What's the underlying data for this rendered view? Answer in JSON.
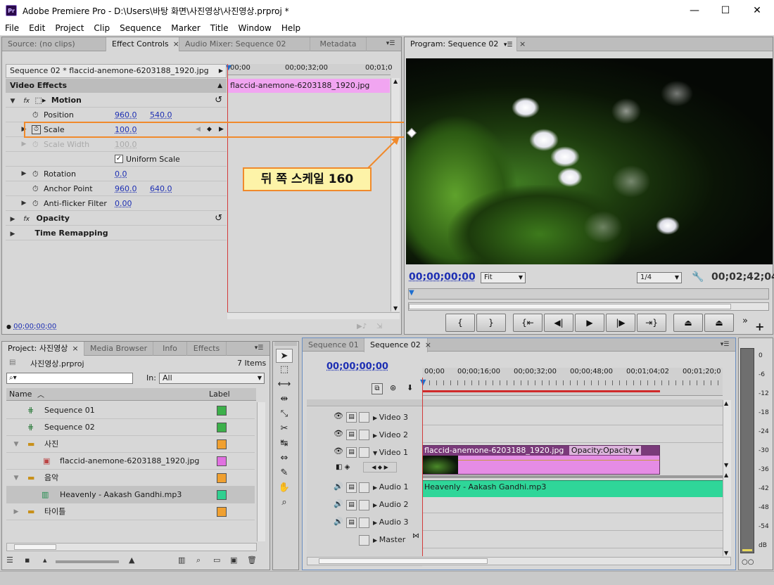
{
  "window": {
    "title": "Adobe Premiere Pro - D:\\Users\\바탕 화면\\사진영상\\사진영상.prproj *",
    "app_icon": "Pr"
  },
  "menu": [
    "File",
    "Edit",
    "Project",
    "Clip",
    "Sequence",
    "Marker",
    "Title",
    "Window",
    "Help"
  ],
  "source_panel": {
    "tabs": [
      "Source: (no clips)",
      "Effect Controls",
      "Audio Mixer: Sequence 02",
      "Metadata"
    ],
    "clip_header": "Sequence 02 * flaccid-anemone-6203188_1920.jpg",
    "ruler": [
      "00;00",
      "00;00;32;00",
      "00;01;0"
    ],
    "clip_bar": "flaccid-anemone-6203188_1920.jpg",
    "video_effects_label": "Video Effects",
    "motion": "Motion",
    "params": {
      "position": {
        "label": "Position",
        "v1": "960.0",
        "v2": "540.0"
      },
      "scale": {
        "label": "Scale",
        "v1": "100.0"
      },
      "scale_width": {
        "label": "Scale Width",
        "v1": "100.0"
      },
      "uniform": "Uniform Scale",
      "rotation": {
        "label": "Rotation",
        "v1": "0.0"
      },
      "anchor": {
        "label": "Anchor Point",
        "v1": "960.0",
        "v2": "640.0"
      },
      "antiflicker": {
        "label": "Anti-flicker Filter",
        "v1": "0.00"
      }
    },
    "opacity": "Opacity",
    "time_remap": "Time Remapping",
    "timecode": "00;00;00;00",
    "callout": "뒤 쪽 스케일 160"
  },
  "program_panel": {
    "tab": "Program: Sequence 02",
    "timecode": "00;00;00;00",
    "fit": "Fit",
    "quality": "1/4",
    "duration": "00;02;42;04"
  },
  "project_panel": {
    "tabs": [
      "Project: 사진영상",
      "Media Browser",
      "Info",
      "Effects"
    ],
    "file": "사진영상.prproj",
    "items_count": "7 Items",
    "in_label": "In:",
    "in_value": "All",
    "col_name": "Name",
    "col_label": "Label",
    "rows": [
      {
        "name": "Sequence 01",
        "color": "#3cb04a",
        "indent": 0
      },
      {
        "name": "Sequence 02",
        "color": "#3cb04a",
        "indent": 0
      },
      {
        "name": "사진",
        "color": "#f0a030",
        "indent": 0
      },
      {
        "name": "flaccid-anemone-6203188_1920.jpg",
        "color": "#e070e0",
        "indent": 1
      },
      {
        "name": "음악",
        "color": "#f0a030",
        "indent": 0
      },
      {
        "name": "Heavenly - Aakash Gandhi.mp3",
        "color": "#30d090",
        "indent": 1
      },
      {
        "name": "타이틀",
        "color": "#f0a030",
        "indent": 0
      }
    ]
  },
  "timeline": {
    "tabs": [
      "Sequence 01",
      "Sequence 02"
    ],
    "timecode": "00;00;00;00",
    "ruler": [
      "00;00",
      "00;00;16;00",
      "00;00;32;00",
      "00;00;48;00",
      "00;01;04;02",
      "00;01;20;0"
    ],
    "tracks": {
      "v3": "Video 3",
      "v2": "Video 2",
      "v1": "Video 1",
      "a1": "Audio 1",
      "a2": "Audio 2",
      "a3": "Audio 3",
      "master": "Master"
    },
    "video_clip": "flaccid-anemone-6203188_1920.jpg",
    "video_clip_fx": "Opacity:Opacity",
    "audio_clip": "Heavenly - Aakash Gandhi.mp3"
  },
  "meter": {
    "ticks": [
      "0",
      "-6",
      "-12",
      "-18",
      "-24",
      "-30",
      "-36",
      "-42",
      "-48",
      "-54",
      "dB"
    ]
  }
}
